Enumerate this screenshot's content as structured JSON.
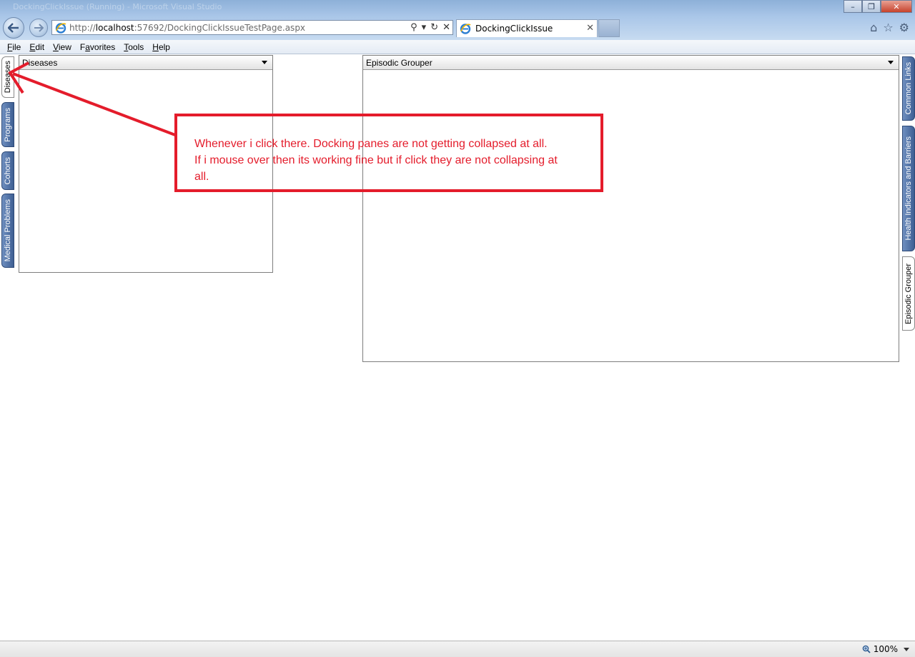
{
  "window": {
    "title_ghost": "DockingClickIssue (Running) - Microsoft Visual Studio",
    "minimize": "–",
    "restore": "❐",
    "close": "✕"
  },
  "address": {
    "url_prefix": "http://",
    "url_host": "localhost",
    "url_rest": ":57692/DockingClickIssueTestPage.aspx",
    "search_glyph": "⚲",
    "dropdown_glyph": "▾",
    "refresh_glyph": "↻",
    "stop_glyph": "✕"
  },
  "tab": {
    "label": "DockingClickIssue",
    "close": "✕"
  },
  "toolbar_icons": {
    "home": "⌂",
    "favorites": "☆",
    "tools": "⚙"
  },
  "menu": [
    {
      "label": "File",
      "key": "F",
      "rest": "ile"
    },
    {
      "label": "Edit",
      "key": "E",
      "rest": "dit"
    },
    {
      "label": "View",
      "key": "V",
      "rest": "iew"
    },
    {
      "label": "Favorites",
      "key": "a",
      "pre": "F",
      "rest": "vorites"
    },
    {
      "label": "Tools",
      "key": "T",
      "rest": "ools"
    },
    {
      "label": "Help",
      "key": "H",
      "rest": "elp"
    }
  ],
  "left_tabs": [
    "Diseases",
    "Programs",
    "Cohorts",
    "Medical Problems"
  ],
  "right_tabs": [
    "Common Links",
    "Health Indicators and Barriers",
    "Episodic Grouper"
  ],
  "panes": {
    "left_title": "Diseases",
    "right_title": "Episodic Grouper"
  },
  "annotation": {
    "line1": "Whenever i click there. Docking panes are not getting collapsed at all.",
    "line2": "If i mouse over then its working fine but if click they are not collapsing at",
    "line3": "all.",
    "color": "#e41c2b"
  },
  "status": {
    "zoom": "100%"
  }
}
